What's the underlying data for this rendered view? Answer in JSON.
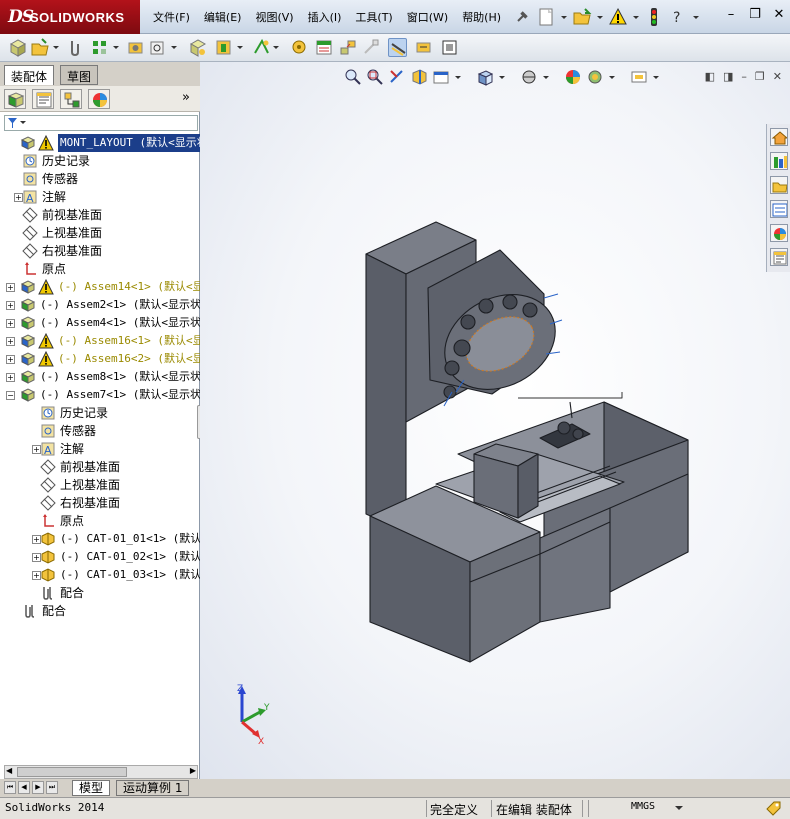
{
  "app": {
    "logo_prefix": "DS",
    "logo_name": "SOLIDWORKS"
  },
  "menu": [
    "文件(F)",
    "编辑(E)",
    "视图(V)",
    "插入(I)",
    "工具(T)",
    "窗口(W)",
    "帮助(H)"
  ],
  "window_controls": {
    "minimize": "–",
    "restore": "❐",
    "close": "✕"
  },
  "panel_tabs": {
    "assembly": "装配体",
    "sketch": "草图"
  },
  "panel_more": "»",
  "tree": [
    {
      "indent": 0,
      "exp": "",
      "icon": "assembly-warning",
      "label": "MONT_LAYOUT  (默认<显示状",
      "style": "sel"
    },
    {
      "indent": 1,
      "exp": "",
      "icon": "history",
      "label": "历史记录",
      "style": "cjk"
    },
    {
      "indent": 1,
      "exp": "",
      "icon": "sensor",
      "label": "传感器",
      "style": "cjk"
    },
    {
      "indent": 1,
      "exp": "+",
      "icon": "annotation",
      "label": "注解",
      "style": "cjk"
    },
    {
      "indent": 1,
      "exp": "",
      "icon": "plane",
      "label": "前视基准面",
      "style": "cjk"
    },
    {
      "indent": 1,
      "exp": "",
      "icon": "plane",
      "label": "上视基准面",
      "style": "cjk"
    },
    {
      "indent": 1,
      "exp": "",
      "icon": "plane",
      "label": "右视基准面",
      "style": "cjk"
    },
    {
      "indent": 1,
      "exp": "",
      "icon": "origin",
      "label": "原点",
      "style": "cjk"
    },
    {
      "indent": 0,
      "exp": "+",
      "icon": "assembly-warning",
      "label": "(-) Assem14<1> (默认<显",
      "style": "warn"
    },
    {
      "indent": 0,
      "exp": "+",
      "icon": "assembly",
      "label": "(-) Assem2<1> (默认<显示状",
      "style": ""
    },
    {
      "indent": 0,
      "exp": "+",
      "icon": "assembly",
      "label": "(-) Assem4<1> (默认<显示状",
      "style": ""
    },
    {
      "indent": 0,
      "exp": "+",
      "icon": "assembly-warning",
      "label": "(-) Assem16<1> (默认<显",
      "style": "warn"
    },
    {
      "indent": 0,
      "exp": "+",
      "icon": "assembly-warning",
      "label": "(-) Assem16<2> (默认<显",
      "style": "warn"
    },
    {
      "indent": 0,
      "exp": "+",
      "icon": "assembly",
      "label": "(-) Assem8<1> (默认<显示状",
      "style": ""
    },
    {
      "indent": 0,
      "exp": "−",
      "icon": "assembly",
      "label": "(-) Assem7<1> (默认<显示状",
      "style": ""
    },
    {
      "indent": 2,
      "exp": "",
      "icon": "history",
      "label": "历史记录",
      "style": "cjk"
    },
    {
      "indent": 2,
      "exp": "",
      "icon": "sensor",
      "label": "传感器",
      "style": "cjk"
    },
    {
      "indent": 2,
      "exp": "+",
      "icon": "annotation",
      "label": "注解",
      "style": "cjk"
    },
    {
      "indent": 2,
      "exp": "",
      "icon": "plane",
      "label": "前视基准面",
      "style": "cjk"
    },
    {
      "indent": 2,
      "exp": "",
      "icon": "plane",
      "label": "上视基准面",
      "style": "cjk"
    },
    {
      "indent": 2,
      "exp": "",
      "icon": "plane",
      "label": "右视基准面",
      "style": "cjk"
    },
    {
      "indent": 2,
      "exp": "",
      "icon": "origin",
      "label": "原点",
      "style": "cjk"
    },
    {
      "indent": 2,
      "exp": "+",
      "icon": "part",
      "label": "(-) CAT-01_01<1> (默认<",
      "style": ""
    },
    {
      "indent": 2,
      "exp": "+",
      "icon": "part",
      "label": "(-) CAT-01_02<1> (默认<",
      "style": ""
    },
    {
      "indent": 2,
      "exp": "+",
      "icon": "part",
      "label": "(-) CAT-01_03<1> (默认<",
      "style": ""
    },
    {
      "indent": 2,
      "exp": "",
      "icon": "mates",
      "label": "配合",
      "style": "cjk"
    },
    {
      "indent": 1,
      "exp": "",
      "icon": "mates",
      "label": "配合",
      "style": "cjk"
    }
  ],
  "bottom_tabs": {
    "model": "模型",
    "motion": "运动算例 1"
  },
  "status": {
    "app_version": "SolidWorks 2014",
    "defined": "完全定义",
    "editing": "在编辑 装配体",
    "units": "MMGS"
  },
  "triad": {
    "x": "X",
    "y": "Y",
    "z": "Z"
  },
  "colors": {
    "selection": "#1b3e8a",
    "model_body": "#5c606c",
    "warning": "#f0c800",
    "cyan_rail": "#22c4c8"
  }
}
